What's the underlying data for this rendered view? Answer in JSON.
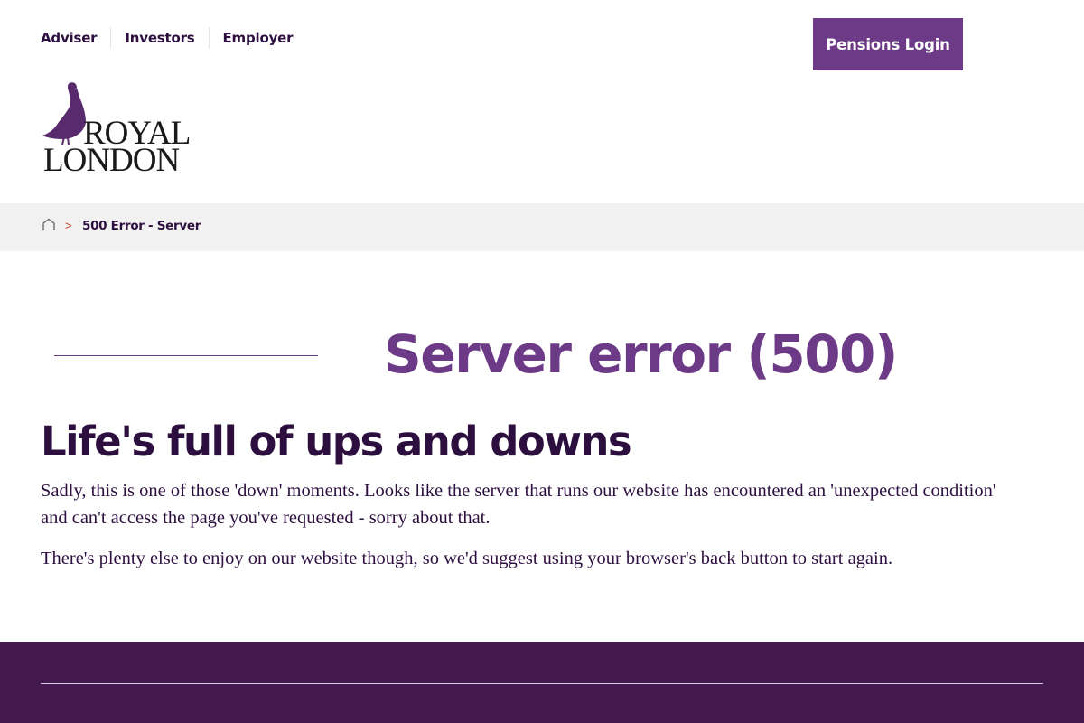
{
  "nav": {
    "links": [
      "Adviser",
      "Investors",
      "Employer"
    ],
    "login_label": "Pensions Login"
  },
  "logo": {
    "line1": "ROYAL",
    "line2": "LONDON"
  },
  "breadcrumb": {
    "separator": ">",
    "current": "500 Error - Server"
  },
  "main": {
    "error_title": "Server error (500)",
    "headline": "Life's full of ups and downs",
    "paragraph1": "Sadly, this is one of those 'down' moments. Looks like the server that runs our website has encountered an 'unexpected condition' and can't access the page you've requested - sorry about that.",
    "paragraph2": "There's plenty else to enjoy on our website though, so we'd suggest using your browser's back button to start again."
  },
  "colors": {
    "brand_purple": "#6d3a87",
    "deep_purple": "#2d0f3f",
    "footer_purple": "#43194f"
  }
}
